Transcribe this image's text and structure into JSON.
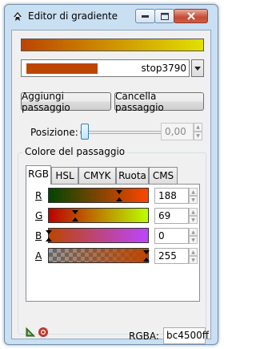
{
  "window": {
    "title": "Editor di gradiente",
    "icon": "inkscape-gradient-icon"
  },
  "gradient": {
    "start_color": "#bc4500",
    "end_color": "#e2e000"
  },
  "stop_selector": {
    "selected": "stop3790",
    "swatch_color": "#bc4500"
  },
  "buttons": {
    "add": "Aggiungi passaggio",
    "delete": "Cancella passaggio"
  },
  "position": {
    "label": "Posizione:",
    "value": "0,00",
    "slider_fraction": 0
  },
  "stop_color": {
    "group_label": "Colore del passaggio",
    "tabs": [
      "RGB",
      "HSL",
      "CMYK",
      "Ruota",
      "CMS"
    ],
    "active_tab": "RGB",
    "channels": [
      {
        "label": "R",
        "value": "188"
      },
      {
        "label": "G",
        "value": "69"
      },
      {
        "label": "B",
        "value": "0"
      },
      {
        "label": "A",
        "value": "255"
      }
    ],
    "rgba_label": "RGBA:",
    "rgba_value": "bc4500ff"
  }
}
